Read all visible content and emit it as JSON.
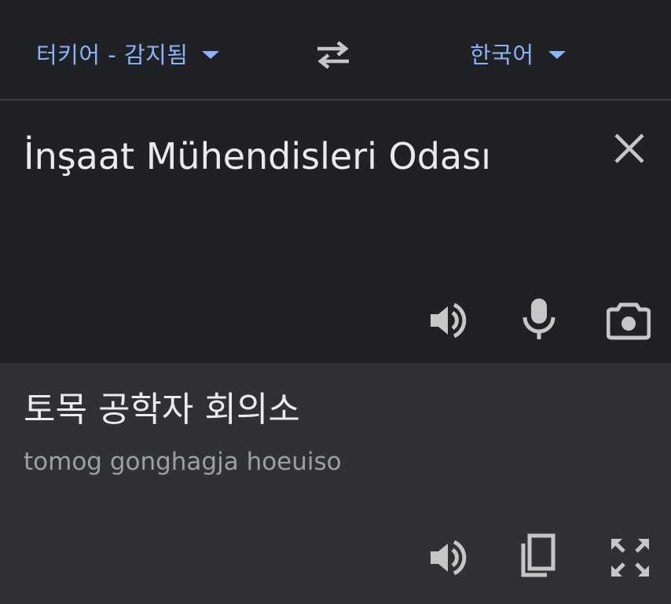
{
  "language_bar": {
    "source_language": "터키어 - 감지됨",
    "target_language": "한국어",
    "swap_icon": "swap-arrows-icon",
    "dropdown_icon": "caret-down-icon"
  },
  "source": {
    "text": "İnşaat Mühendisleri Odası",
    "clear_icon": "close-icon",
    "listen_icon": "speaker-icon",
    "mic_icon": "microphone-icon",
    "camera_icon": "camera-icon"
  },
  "result": {
    "text": "토목 공학자 회의소",
    "romanization": "tomog gonghagja hoeuiso",
    "listen_icon": "speaker-icon",
    "copy_icon": "copy-icon",
    "fullscreen_icon": "fullscreen-icon"
  },
  "colors": {
    "background": "#202124",
    "result_background": "#303134",
    "accent": "#8ab4f8",
    "text_primary": "#e8eaed",
    "text_secondary": "#9aa0a6",
    "icon": "#c4c7c5"
  }
}
